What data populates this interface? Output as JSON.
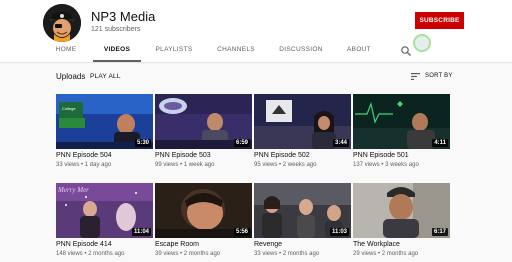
{
  "channel": {
    "name": "NP3 Media",
    "subscribers": "121 subscribers",
    "subscribe_label": "SUBSCRIBE",
    "avatar_icon": "pirate-mascot-icon"
  },
  "tabs": [
    {
      "label": "HOME",
      "active": false
    },
    {
      "label": "VIDEOS",
      "active": true
    },
    {
      "label": "PLAYLISTS",
      "active": false
    },
    {
      "label": "CHANNELS",
      "active": false
    },
    {
      "label": "DISCUSSION",
      "active": false
    },
    {
      "label": "ABOUT",
      "active": false
    }
  ],
  "section": {
    "title": "Uploads",
    "play_all": "PLAY ALL",
    "sort_label": "SORT BY"
  },
  "videos": [
    {
      "title": "PNN Episode 504",
      "views": "33 views",
      "age": "1 day ago",
      "duration": "5:30"
    },
    {
      "title": "PNN Episode 503",
      "views": "99 views",
      "age": "1 week ago",
      "duration": "6:59"
    },
    {
      "title": "PNN Episode 502",
      "views": "95 views",
      "age": "2 weeks ago",
      "duration": "3:44"
    },
    {
      "title": "PNN Episode 501",
      "views": "137 views",
      "age": "3 weeks ago",
      "duration": "4:11"
    },
    {
      "title": "PNN Episode 414",
      "views": "148 views",
      "age": "2 months ago",
      "duration": "11:04"
    },
    {
      "title": "Escape Room",
      "views": "39 views",
      "age": "2 months ago",
      "duration": "5:56"
    },
    {
      "title": "Revenge",
      "views": "33 views",
      "age": "2 months ago",
      "duration": "11:03"
    },
    {
      "title": "The Workplace",
      "views": "29 views",
      "age": "2 months ago",
      "duration": "6:17"
    }
  ],
  "colors": {
    "subscribe": "#cc0000",
    "background": "#f9f9f9",
    "text_secondary": "#606060"
  }
}
